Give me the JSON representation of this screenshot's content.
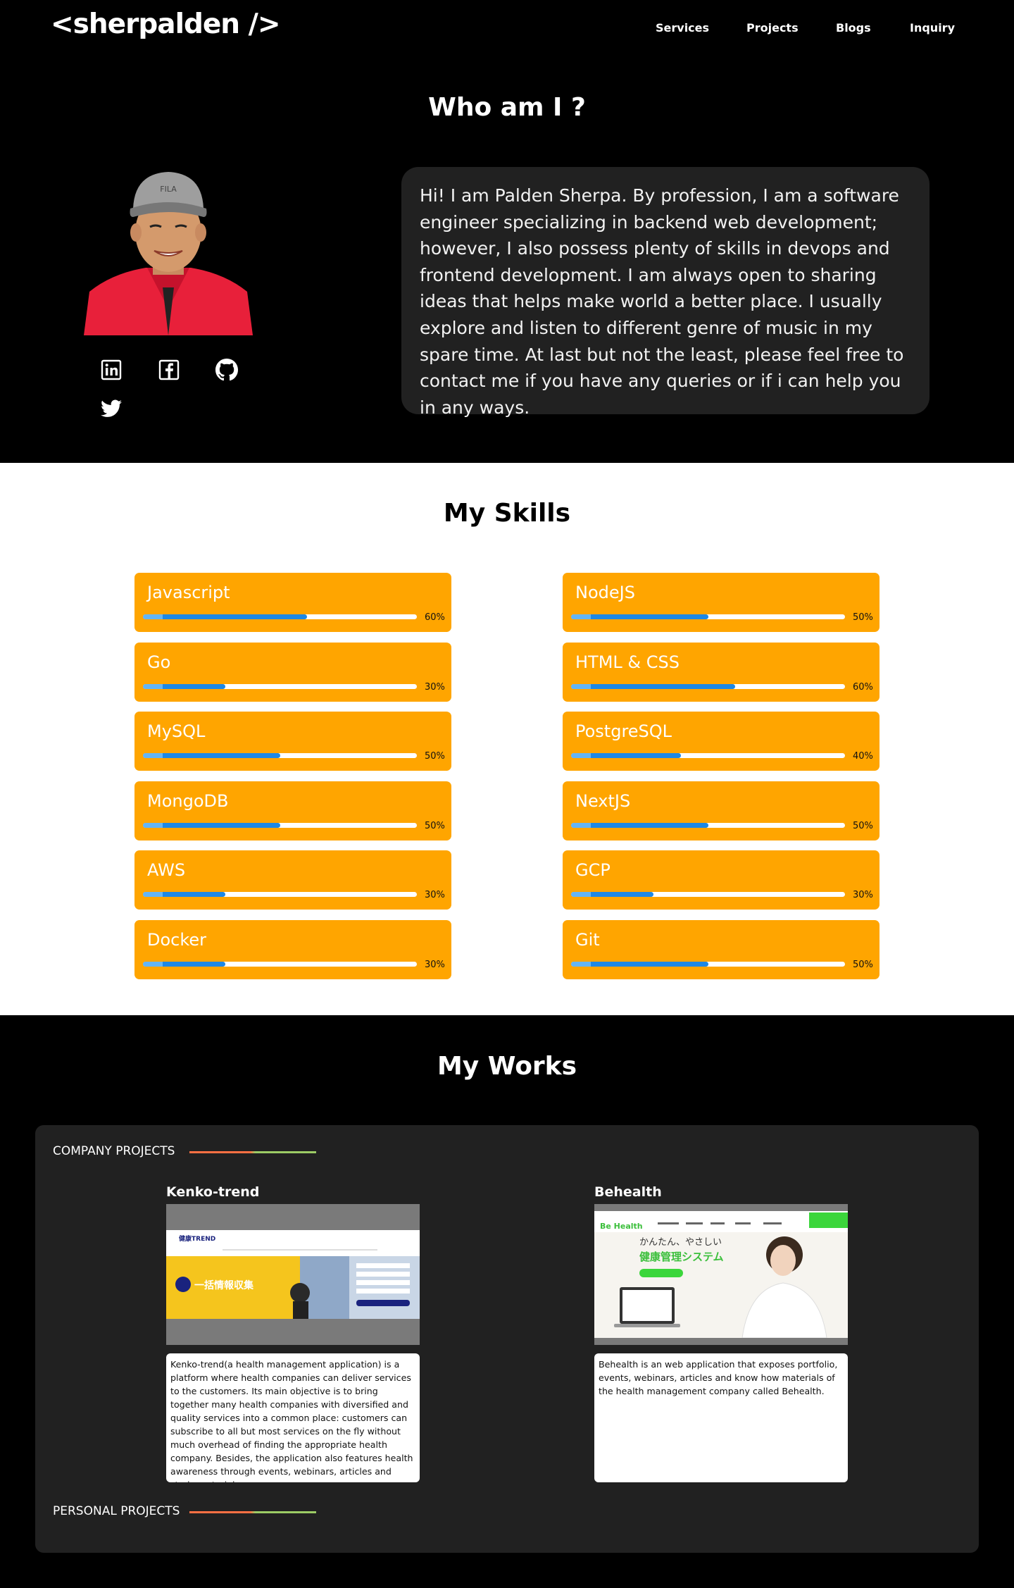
{
  "header": {
    "logo": "<sherpalden />",
    "nav": [
      "Services",
      "Projects",
      "Blogs",
      "Inquiry"
    ]
  },
  "about": {
    "title": "Who am I ?",
    "bio": "Hi! I am Palden Sherpa. By profession, I am a software engineer specializing in backend web development; however, I also possess plenty of skills in devops and frontend development. I am always open to sharing ideas that helps make world a better place. I usually explore and listen to different genre of music in my spare time. At last but not the least, please feel free to contact me if you have any queries or if i can help you in any ways.",
    "social": [
      "linkedin-icon",
      "facebook-icon",
      "github-icon",
      "twitter-icon"
    ]
  },
  "skills": {
    "title": "My Skills",
    "left": [
      {
        "name": "Javascript",
        "level": 60,
        "label": "60%"
      },
      {
        "name": "Go",
        "level": 30,
        "label": "30%"
      },
      {
        "name": "MySQL",
        "level": 50,
        "label": "50%"
      },
      {
        "name": "MongoDB",
        "level": 50,
        "label": "50%"
      },
      {
        "name": "AWS",
        "level": 30,
        "label": "30%"
      },
      {
        "name": "Docker",
        "level": 30,
        "label": "30%"
      }
    ],
    "right": [
      {
        "name": "NodeJS",
        "level": 50,
        "label": "50%"
      },
      {
        "name": "HTML & CSS",
        "level": 60,
        "label": "60%"
      },
      {
        "name": "PostgreSQL",
        "level": 40,
        "label": "40%"
      },
      {
        "name": "NextJS",
        "level": 50,
        "label": "50%"
      },
      {
        "name": "GCP",
        "level": 30,
        "label": "30%"
      },
      {
        "name": "Git",
        "level": 50,
        "label": "50%"
      }
    ]
  },
  "works": {
    "title": "My Works",
    "company_label": "COMPANY PROJECTS",
    "personal_label": "PERSONAL PROJECTS",
    "projects": [
      {
        "title": "Kenko-trend",
        "description": "Kenko-trend(a health management application) is a platform where health companies can deliver services to the customers. Its main objective is to bring together many health companies with diversified and quality services into a common place: customers can subscribe to all but most services on the fly without much overhead of finding the appropriate health company. Besides, the application also features health awareness through events, webinars, articles and study materials.",
        "shot": {
          "logo": "健康TREND",
          "headline": "一括情報収集"
        }
      },
      {
        "title": "Behealth",
        "description": "Behealth is an web application that exposes portfolio, events, webinars, articles and know how materials of the health management company called Behealth.",
        "shot": {
          "logo": "Be Health",
          "line1": "かんたん、やさしい",
          "line2": "健康管理システム"
        }
      }
    ]
  },
  "colors": {
    "background": "#000000",
    "card": "#212121",
    "skill_card": "#ffa500",
    "skill_bar": "#1e88e5",
    "accent_orange": "#ff7043",
    "accent_green": "#9ccc65"
  }
}
